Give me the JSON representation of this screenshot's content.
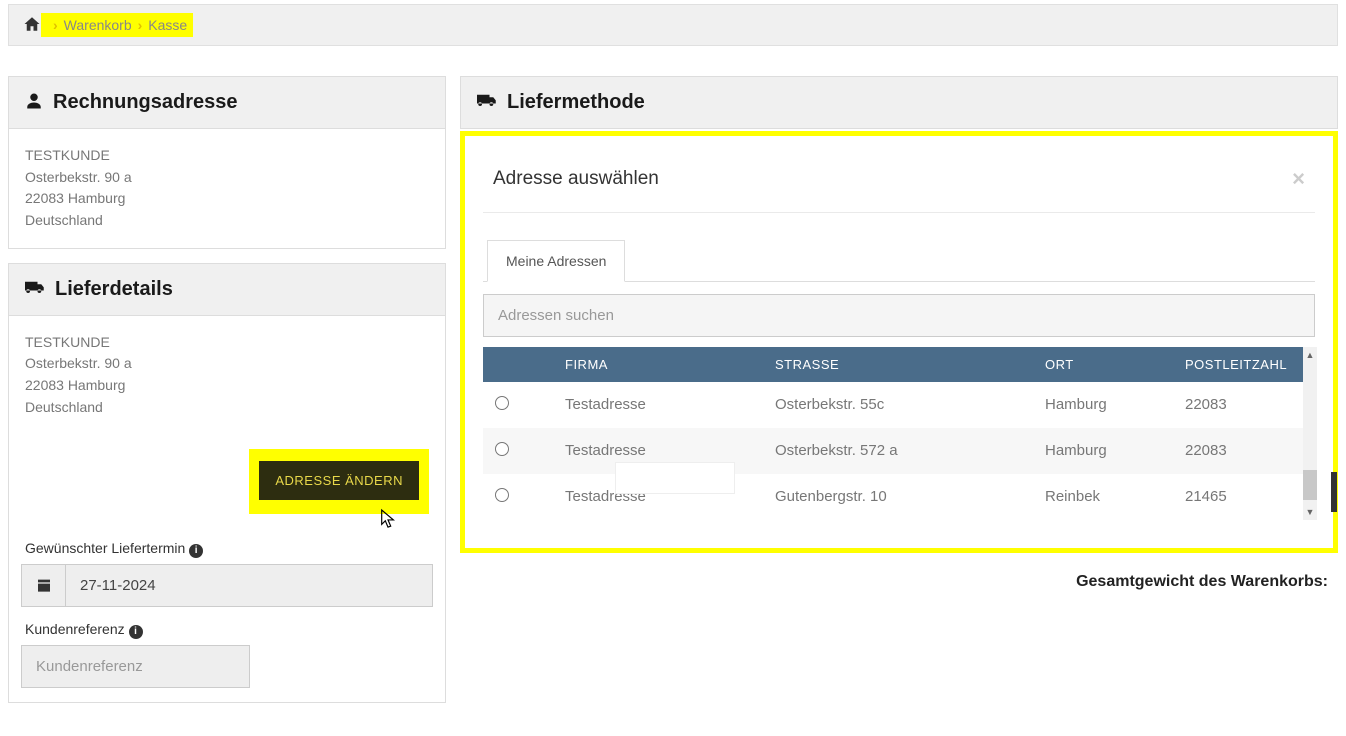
{
  "breadcrumb": {
    "cart": "Warenkorb",
    "checkout": "Kasse"
  },
  "billing": {
    "title": "Rechnungsadresse",
    "name": "TESTKUNDE",
    "street": "Osterbekstr. 90 a",
    "cityline": "22083 Hamburg",
    "country": "Deutschland"
  },
  "delivery": {
    "title": "Lieferdetails",
    "name": "TESTKUNDE",
    "street": "Osterbekstr. 90 a",
    "cityline": "22083 Hamburg",
    "country": "Deutschland",
    "change_btn": "ADRESSE ÄNDERN",
    "date_label": "Gewünschter Liefertermin",
    "date_value": "27-11-2024",
    "ref_label": "Kundenreferenz",
    "ref_placeholder": "Kundenreferenz"
  },
  "method": {
    "title": "Liefermethode"
  },
  "modal": {
    "title": "Adresse auswählen",
    "tab": "Meine Adressen",
    "search_placeholder": "Adressen suchen",
    "headers": {
      "firma": "FIRMA",
      "strasse": "STRASSE",
      "ort": "ORT",
      "plz": "POSTLEITZAHL"
    },
    "rows": [
      {
        "firma": "Testadresse",
        "strasse": "Osterbekstr. 55c",
        "ort": "Hamburg",
        "plz": "22083"
      },
      {
        "firma": "Testadresse",
        "strasse": "Osterbekstr. 572 a",
        "ort": "Hamburg",
        "plz": "22083"
      },
      {
        "firma": "Testadresse",
        "strasse": "Gutenbergstr. 10",
        "ort": "Reinbek",
        "plz": "21465"
      }
    ]
  },
  "weight_label": "Gesamtgewicht des Warenkorbs:"
}
